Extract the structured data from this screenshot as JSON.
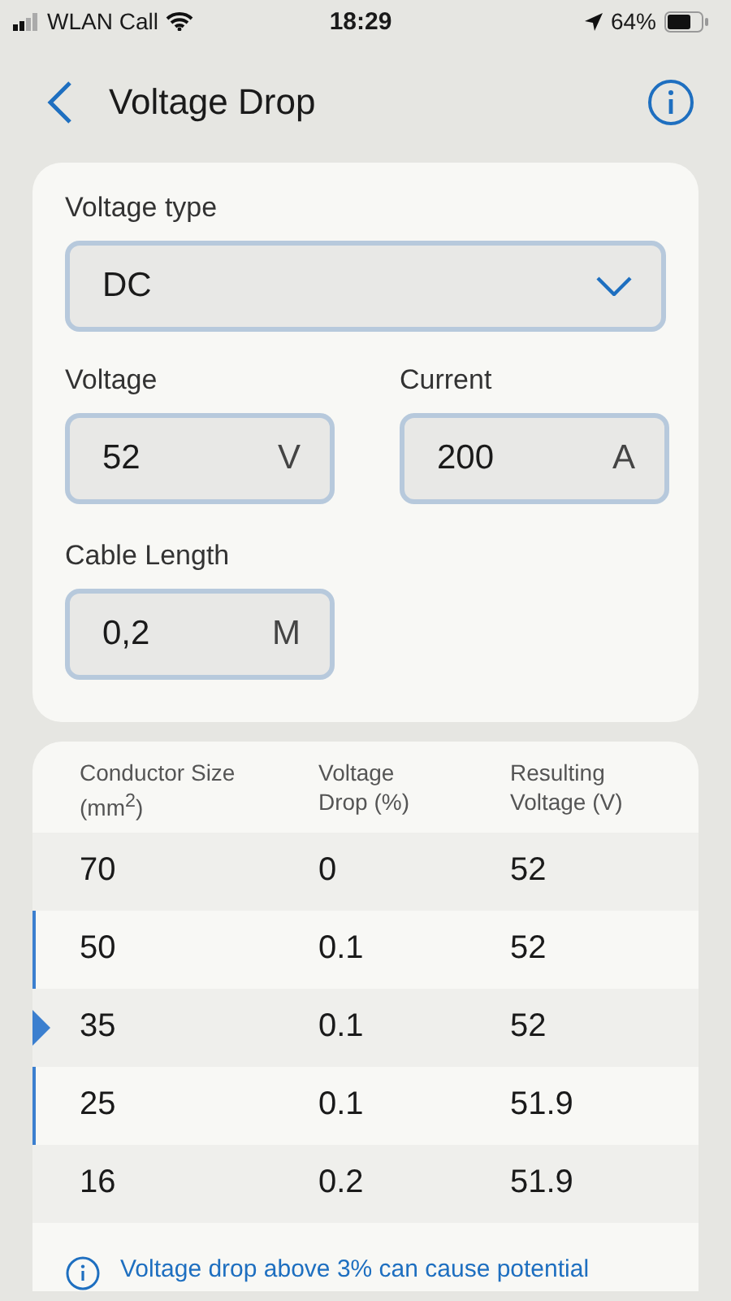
{
  "status_bar": {
    "carrier": "WLAN Call",
    "time": "18:29",
    "battery": "64%"
  },
  "header": {
    "title": "Voltage Drop"
  },
  "voltage_type": {
    "label": "Voltage type",
    "value": "DC"
  },
  "fields": [
    {
      "label": "Voltage",
      "value": "52",
      "unit": "V"
    },
    {
      "label": "Current",
      "value": "200",
      "unit": "A"
    },
    {
      "label": "Cable Length",
      "value": "0,2",
      "unit": "M"
    }
  ],
  "table": {
    "columns": [
      "Conductor  Size (mm$^{2}$)",
      "Voltage Drop (%)",
      "Resulting Voltage (V)"
    ],
    "rows": [
      {
        "cells": [
          "70",
          "0",
          "52"
        ],
        "selected": false
      },
      {
        "cells": [
          "50",
          "0.1",
          "52"
        ],
        "selected": false
      },
      {
        "cells": [
          "35",
          "0.1",
          "52"
        ],
        "selected": true
      },
      {
        "cells": [
          "25",
          "0.1",
          "51.9"
        ],
        "selected": false
      },
      {
        "cells": [
          "16",
          "0.2",
          "51.9"
        ],
        "selected": false
      }
    ],
    "note": "Voltage drop above 3% can cause potential"
  }
}
